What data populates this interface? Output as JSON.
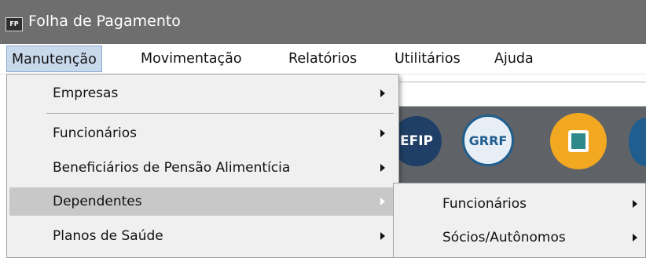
{
  "window": {
    "icon_text": "FP",
    "title": "Folha de Pagamento"
  },
  "menubar": {
    "items": [
      {
        "label": "Manutenção"
      },
      {
        "label": "Movimentação"
      },
      {
        "label": "Relatórios"
      },
      {
        "label": "Utilitários"
      },
      {
        "label": "Ajuda"
      }
    ]
  },
  "dropdown": {
    "items": [
      {
        "label": "Empresas",
        "submenu": true
      },
      {
        "label": "Funcionários",
        "submenu": true
      },
      {
        "label": "Beneficiários de Pensão Alimentícia",
        "submenu": true
      },
      {
        "label": "Dependentes",
        "submenu": true,
        "highlighted": true
      },
      {
        "label": "Planos de Saúde",
        "submenu": true
      }
    ]
  },
  "submenu": {
    "items": [
      {
        "label": "Funcionários",
        "submenu": true
      },
      {
        "label": "Sócios/Autônomos",
        "submenu": true
      }
    ]
  },
  "toolbar": {
    "buttons": [
      {
        "label": "EFIP",
        "icon": "sefip-icon",
        "color": "#1f3f66"
      },
      {
        "label": "GRRF",
        "icon": "grrf-icon",
        "color": "#1f5e8f"
      },
      {
        "label": "",
        "icon": "document-icon",
        "color": "#f2a820"
      }
    ]
  },
  "colors": {
    "titlebar": "#6e6e6e",
    "menu_active": "#c9d9ec",
    "highlight": "#c8c8c8",
    "menu_bg": "#f0f0f0"
  }
}
